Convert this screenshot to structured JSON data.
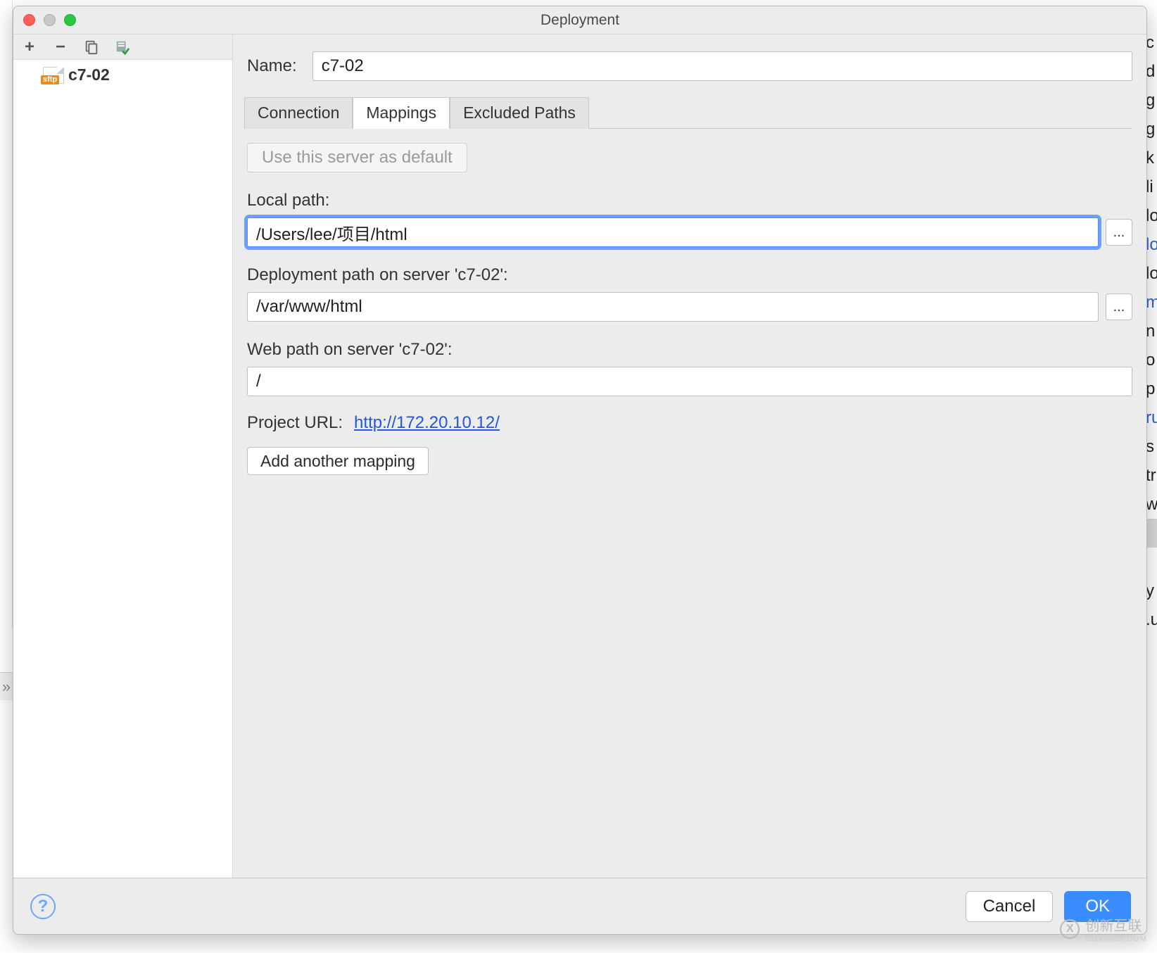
{
  "bg_toc": {
    "items": [
      "c",
      "d",
      "g",
      "g",
      "k",
      "li",
      "lo",
      "lo",
      "lo",
      "m",
      "n",
      "o",
      "p",
      "ru",
      "s",
      "tr",
      "w",
      "",
      "",
      "y",
      ".u"
    ],
    "blue_indices": [
      7,
      9,
      13
    ],
    "sel_index": 17
  },
  "dialog": {
    "title": "Deployment",
    "left_toolbar": {
      "add_tip": "+",
      "remove_tip": "−"
    },
    "servers": [
      {
        "name": "c7-02",
        "badge": "sftp"
      }
    ],
    "name_label": "Name:",
    "name_value": "c7-02",
    "tabs": [
      {
        "label": "Connection",
        "id": "connection"
      },
      {
        "label": "Mappings",
        "id": "mappings",
        "active": true
      },
      {
        "label": "Excluded Paths",
        "id": "excluded"
      }
    ],
    "defaults_btn": "Use this server as default",
    "local_path_label": "Local path:",
    "local_path_value": "/Users/lee/项目/html",
    "deploy_path_label": "Deployment path on server 'c7-02':",
    "deploy_path_value": "/var/www/html",
    "web_path_label": "Web path on server 'c7-02':",
    "web_path_value": "/",
    "project_url_label": "Project URL:",
    "project_url_value": "http://172.20.10.12/",
    "add_mapping_btn": "Add another mapping",
    "browse_btn": "...",
    "help_tip": "?",
    "cancel_btn": "Cancel",
    "ok_btn": "OK"
  },
  "watermark": {
    "brand": "创新互联",
    "sub": "CDXWCX.COM",
    "logo": "X"
  }
}
